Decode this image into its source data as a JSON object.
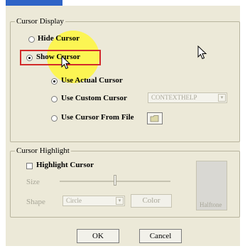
{
  "cursor_display": {
    "legend": "Cursor Display",
    "hide_label": "Hide Cursor",
    "show_label": "Show Cursor",
    "actual_label": "Use Actual Cursor",
    "custom_label": "Use Custom Cursor",
    "custom_value": "CONTEXTHELP",
    "from_file_label": "Use Cursor From File"
  },
  "cursor_highlight": {
    "legend": "Cursor Highlight",
    "checkbox_label": "Highlight Cursor",
    "size_label": "Size",
    "shape_label": "Shape",
    "shape_value": "Circle",
    "color_button": "Color",
    "preview_label": "Halftone",
    "size_slider_fraction": 0.5
  },
  "buttons": {
    "ok": "OK",
    "cancel": "Cancel"
  },
  "icons": {
    "pointer": "mouse-pointer-icon",
    "browse": "folder-browse-icon",
    "arrow": "dropdown-arrow-icon"
  }
}
